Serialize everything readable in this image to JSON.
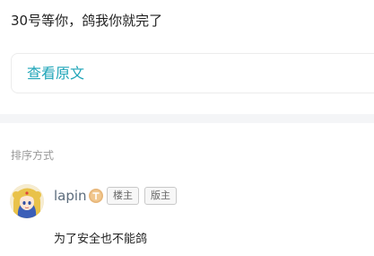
{
  "post": {
    "text": "30号等你，鸽我你就完了"
  },
  "original": {
    "link_label": "查看原文"
  },
  "comments": {
    "sort_label": "排序方式",
    "first": {
      "username": "lapin",
      "level_badge_icon": "level-badge-icon",
      "tags": [
        "楼主",
        "版主"
      ],
      "text": "为了安全也不能鸽"
    }
  },
  "colors": {
    "accent": "#1fa5b8",
    "username": "#5b6b7b",
    "muted": "#9a9a9a",
    "badge": "#e8b77a"
  }
}
